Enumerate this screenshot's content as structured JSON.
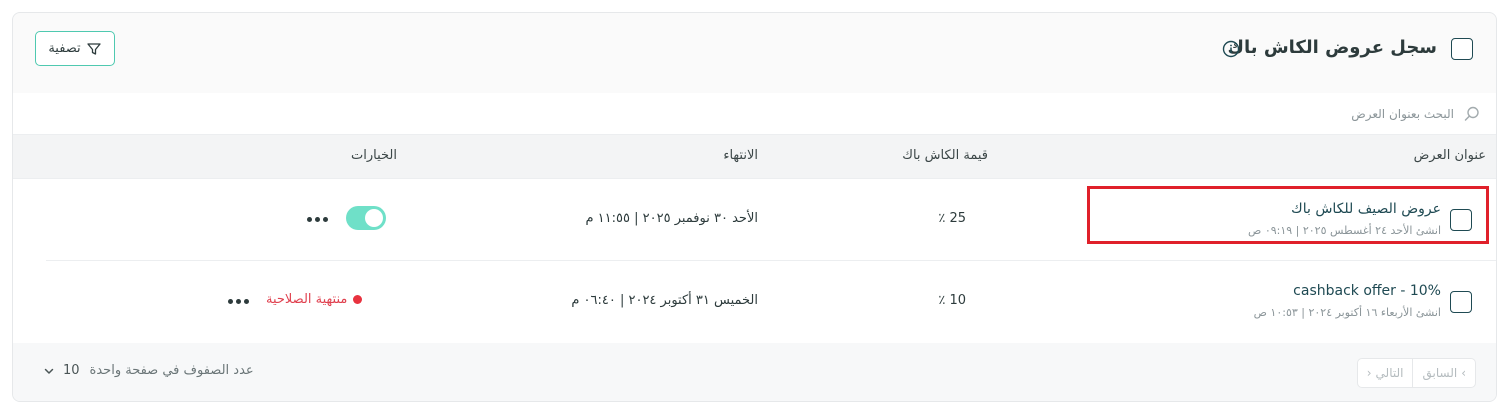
{
  "header": {
    "title": "سجل عروض الكاش باك",
    "filter_label": "تصفية",
    "icons": {
      "info": "info-icon",
      "filter": "filter-icon"
    }
  },
  "search": {
    "placeholder": "البحث بعنوان العرض",
    "icon": "search-icon"
  },
  "table": {
    "columns": {
      "title": "عنوان العرض",
      "cashback_value": "قيمة الكاش باك",
      "end": "الانتهاء",
      "options": "الخيارات"
    },
    "rows": [
      {
        "title": "عروض الصيف للكاش باك",
        "created": "انشئ الأحد ٢٤ أغسطس ٢٠٢٥ | ٠٩:١٩ ص",
        "cashback_value": "25 ٪",
        "end": "الأحد ٣٠ نوفمبر ٢٠٢٥ | ١١:٥٥ م",
        "status": "active",
        "toggle_on": true
      },
      {
        "title": "cashback offer - 10%",
        "created": "انشئ الأربعاء ١٦ أكتوبر ٢٠٢٤ | ١٠:٥٣ ص",
        "cashback_value": "10 ٪",
        "end": "الخميس ٣١ أكتوبر ٢٠٢٤ | ٠٦:٤٠ م",
        "status": "expired",
        "status_label": "منتهية الصلاحية"
      }
    ]
  },
  "footer": {
    "prev_label": "السابق",
    "next_label": "التالي",
    "rows_per_page_label": "عدد الصفوف في صفحة واحدة",
    "rows_per_page_value": "10"
  },
  "colors": {
    "accent": "#4fc9b0",
    "toggle_on": "#6fe0c8",
    "expired": "#e0414f",
    "highlight": "#e0202a",
    "dark_teal": "#1f4a53"
  }
}
